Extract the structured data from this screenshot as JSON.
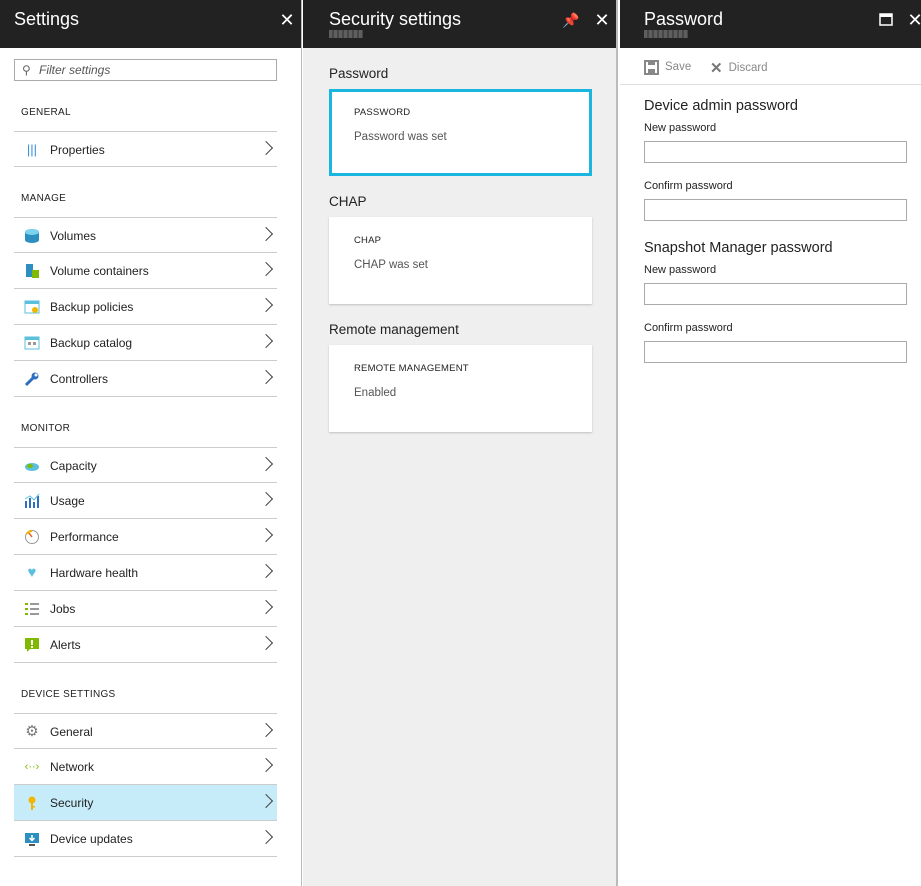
{
  "settings": {
    "title": "Settings",
    "filter_placeholder": "Filter settings",
    "sections": {
      "general": "GENERAL",
      "manage": "MANAGE",
      "monitor": "MONITOR",
      "device": "DEVICE SETTINGS"
    },
    "general_items": [
      {
        "label": "Properties",
        "icon": "properties-icon"
      }
    ],
    "manage_items": [
      {
        "label": "Volumes",
        "icon": "volumes-icon"
      },
      {
        "label": "Volume containers",
        "icon": "volume-containers-icon"
      },
      {
        "label": "Backup policies",
        "icon": "backup-policies-icon"
      },
      {
        "label": "Backup catalog",
        "icon": "backup-catalog-icon"
      },
      {
        "label": "Controllers",
        "icon": "wrench-icon"
      }
    ],
    "monitor_items": [
      {
        "label": "Capacity",
        "icon": "capacity-icon"
      },
      {
        "label": "Usage",
        "icon": "usage-chart-icon"
      },
      {
        "label": "Performance",
        "icon": "gauge-icon"
      },
      {
        "label": "Hardware health",
        "icon": "heart-icon"
      },
      {
        "label": "Jobs",
        "icon": "jobs-list-icon"
      },
      {
        "label": "Alerts",
        "icon": "alert-icon"
      }
    ],
    "device_items": [
      {
        "label": "General",
        "icon": "gear-icon"
      },
      {
        "label": "Network",
        "icon": "network-icon"
      },
      {
        "label": "Security",
        "icon": "key-icon",
        "selected": true
      },
      {
        "label": "Device updates",
        "icon": "device-updates-icon"
      }
    ]
  },
  "security": {
    "title": "Security settings",
    "groups": [
      {
        "heading": "Password",
        "tile_label": "PASSWORD",
        "tile_value": "Password was set",
        "active": true
      },
      {
        "heading": "CHAP",
        "tile_label": "CHAP",
        "tile_value": "CHAP was set"
      },
      {
        "heading": "Remote management",
        "tile_label": "REMOTE MANAGEMENT",
        "tile_value": "Enabled"
      }
    ]
  },
  "password": {
    "title": "Password",
    "save_label": "Save",
    "discard_label": "Discard",
    "device_admin": {
      "heading": "Device admin password",
      "new_label": "New password",
      "confirm_label": "Confirm password"
    },
    "snapshot": {
      "heading": "Snapshot Manager password",
      "new_label": "New password",
      "confirm_label": "Confirm password"
    }
  },
  "colors": {
    "header_bg": "#222222",
    "selected_bg": "#c7ecf9",
    "active_tile_border": "#1ab6e0",
    "blade_bg": "#efefef"
  }
}
